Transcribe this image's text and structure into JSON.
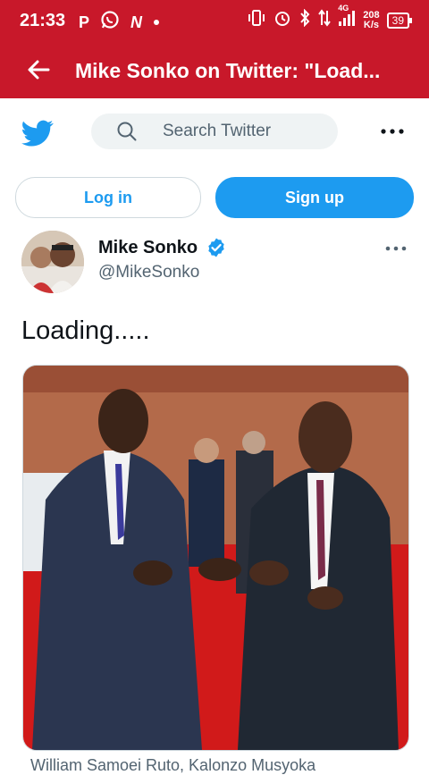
{
  "statusbar": {
    "time": "21:33",
    "left_icons": [
      "p-icon",
      "whatsapp-icon",
      "n-icon",
      "dot-icon"
    ],
    "right_icons": [
      "vibrate-icon",
      "alarm-icon",
      "bluetooth-icon",
      "data-arrows-icon",
      "signal-icon"
    ],
    "network": "4G",
    "speed_value": "208",
    "speed_unit": "K/s",
    "battery": "39"
  },
  "appbar": {
    "title": "Mike Sonko on Twitter: \"Load..."
  },
  "header": {
    "search_placeholder": "Search Twitter"
  },
  "auth": {
    "login_label": "Log in",
    "signup_label": "Sign up"
  },
  "tweet": {
    "author_name": "Mike Sonko",
    "handle": "@MikeSonko",
    "text": "Loading.....",
    "caption": "William Samoei Ruto, Kalonzo Musyoka"
  },
  "colors": {
    "appbar_bg": "#c8182a",
    "twitter_blue": "#1d9bf0",
    "secondary_text": "#536471",
    "search_bg": "#eff3f4"
  }
}
